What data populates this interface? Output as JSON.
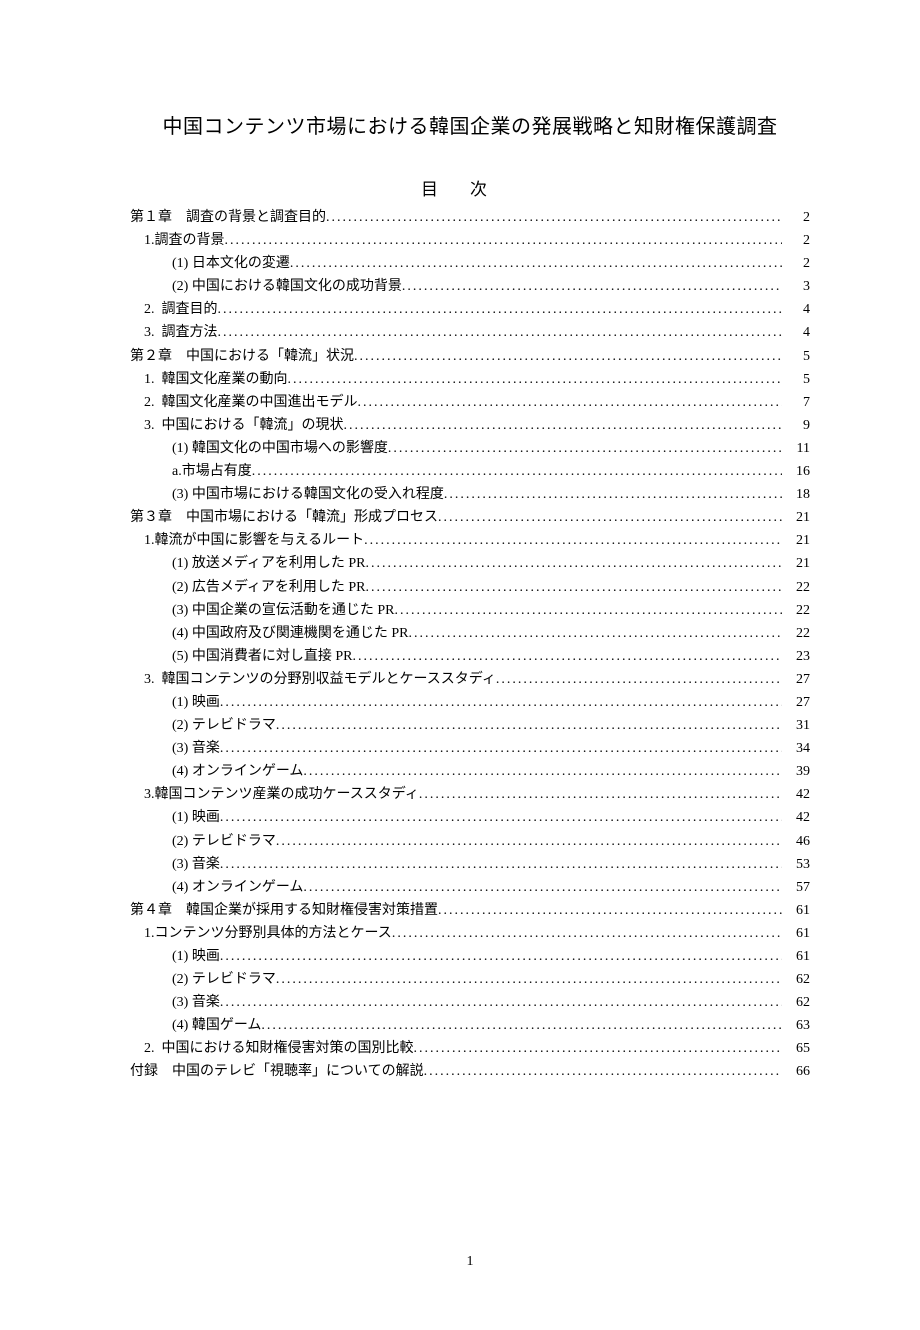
{
  "title": "中国コンテンツ市場における韓国企業の発展戦略と知財権保護調査",
  "toc_heading": "目次",
  "page_number": "1",
  "entries": [
    {
      "indent": 0,
      "label": "第１章　調査の背景と調査目的",
      "page": "2"
    },
    {
      "indent": 1,
      "label": "1.調査の背景",
      "page": "2"
    },
    {
      "indent": 2,
      "label": "(1) 日本文化の変遷",
      "page": "2"
    },
    {
      "indent": 2,
      "label": "(2) 中国における韓国文化の成功背景",
      "page": "3"
    },
    {
      "indent": 1,
      "label": "2.  調査目的",
      "page": "4"
    },
    {
      "indent": 1,
      "label": "3.  調査方法",
      "page": "4"
    },
    {
      "indent": 0,
      "label": "第２章　中国における「韓流」状況",
      "page": "5"
    },
    {
      "indent": 1,
      "label": "1.  韓国文化産業の動向",
      "page": "5"
    },
    {
      "indent": 1,
      "label": "2.  韓国文化産業の中国進出モデル",
      "page": "7"
    },
    {
      "indent": 1,
      "label": "3.  中国における「韓流」の現状",
      "page": "9"
    },
    {
      "indent": 2,
      "label": "(1) 韓国文化の中国市場への影響度",
      "page": "11"
    },
    {
      "indent": 2,
      "label": "a.市場占有度",
      "page": "16"
    },
    {
      "indent": 2,
      "label": "(3) 中国市場における韓国文化の受入れ程度",
      "page": "18"
    },
    {
      "indent": 0,
      "label": "第３章　中国市場における「韓流」形成プロセス",
      "page": "21"
    },
    {
      "indent": 1,
      "label": "1.韓流が中国に影響を与えるルート",
      "page": "21"
    },
    {
      "indent": 2,
      "label": "(1) 放送メディアを利用した PR",
      "page": "21"
    },
    {
      "indent": 2,
      "label": "(2) 広告メディアを利用した PR",
      "page": "22"
    },
    {
      "indent": 2,
      "label": "(3) 中国企業の宣伝活動を通じた PR",
      "page": "22"
    },
    {
      "indent": 2,
      "label": "(4) 中国政府及び関連機関を通じた PR",
      "page": "22"
    },
    {
      "indent": 2,
      "label": "(5) 中国消費者に対し直接 PR",
      "page": "23"
    },
    {
      "indent": 1,
      "label": "3.  韓国コンテンツの分野別収益モデルとケーススタディ",
      "page": "27"
    },
    {
      "indent": 2,
      "label": "(1) 映画",
      "page": "27"
    },
    {
      "indent": 2,
      "label": "(2) テレビドラマ",
      "page": "31"
    },
    {
      "indent": 2,
      "label": "(3) 音楽",
      "page": "34"
    },
    {
      "indent": 2,
      "label": "(4) オンラインゲーム",
      "page": "39"
    },
    {
      "indent": 1,
      "label": "3.韓国コンテンツ産業の成功ケーススタディ",
      "page": "42"
    },
    {
      "indent": 2,
      "label": "(1) 映画",
      "page": "42"
    },
    {
      "indent": 2,
      "label": "(2) テレビドラマ",
      "page": "46"
    },
    {
      "indent": 2,
      "label": "(3) 音楽",
      "page": "53"
    },
    {
      "indent": 2,
      "label": "(4) オンラインゲーム",
      "page": "57"
    },
    {
      "indent": 0,
      "label": "第４章　韓国企業が採用する知財権侵害対策措置",
      "page": "61"
    },
    {
      "indent": 1,
      "label": "1.コンテンツ分野別具体的方法とケース",
      "page": "61"
    },
    {
      "indent": 2,
      "label": "(1) 映画",
      "page": "61"
    },
    {
      "indent": 2,
      "label": "(2) テレビドラマ",
      "page": "62"
    },
    {
      "indent": 2,
      "label": "(3) 音楽",
      "page": "62"
    },
    {
      "indent": 2,
      "label": "(4) 韓国ゲーム",
      "page": "63"
    },
    {
      "indent": 1,
      "label": "2.  中国における知財権侵害対策の国別比較",
      "page": "65"
    },
    {
      "indent": 0,
      "label": "付録　中国のテレビ「視聴率」についての解説",
      "page": "66"
    }
  ]
}
